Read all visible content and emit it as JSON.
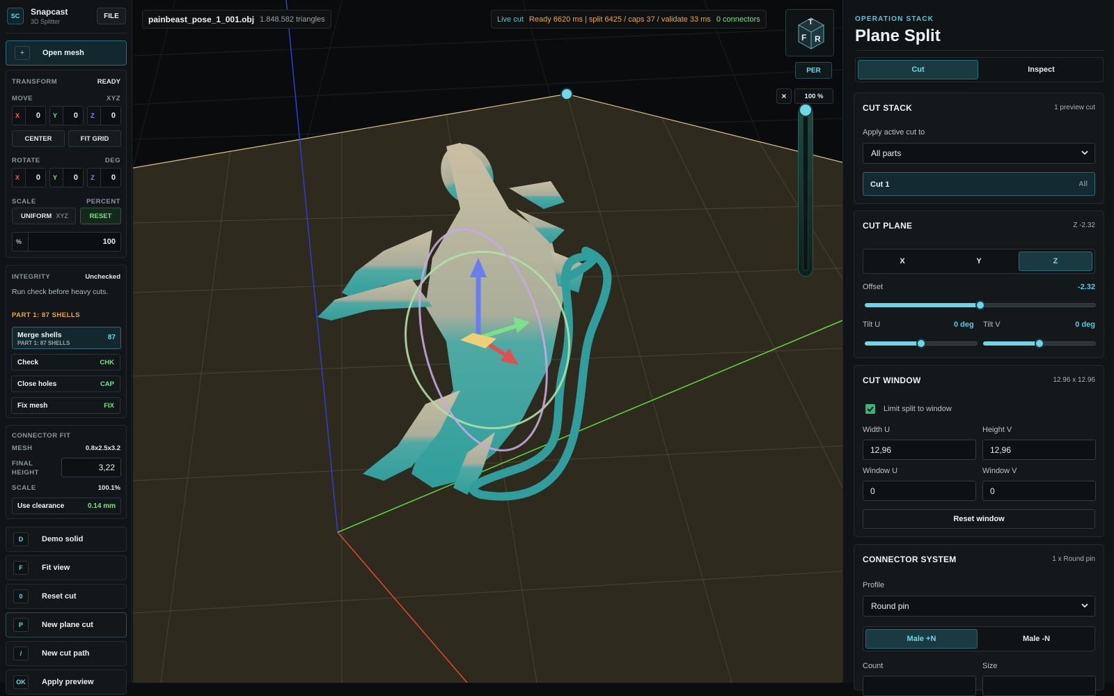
{
  "app": {
    "logo": "SC",
    "name": "Snapcast",
    "subtitle": "3D Splitter",
    "file_label": "FILE"
  },
  "left": {
    "open_mesh": {
      "icon": "+",
      "label": "Open mesh"
    },
    "transform": {
      "title": "TRANSFORM",
      "status": "READY",
      "move_label": "MOVE",
      "move_unit": "XYZ",
      "move": [
        {
          "axis": "X",
          "value": "0"
        },
        {
          "axis": "Y",
          "value": "0"
        },
        {
          "axis": "Z",
          "value": "0"
        }
      ],
      "center": "CENTER",
      "fit_grid": "FIT GRID",
      "rotate_label": "ROTATE",
      "rotate_unit": "DEG",
      "rotate": [
        {
          "axis": "X",
          "value": "0"
        },
        {
          "axis": "Y",
          "value": "0"
        },
        {
          "axis": "Z",
          "value": "0"
        }
      ],
      "scale_label": "SCALE",
      "scale_unit": "PERCENT",
      "uniform": "UNIFORM",
      "uniform_axes": "XYZ",
      "reset": "RESET",
      "percent_symbol": "%",
      "percent_value": "100"
    },
    "integrity": {
      "title": "INTEGRITY",
      "status": "Unchecked",
      "hint": "Run check before heavy cuts.",
      "part_title": "PART 1: 87 SHELLS",
      "merge": {
        "label": "Merge shells",
        "sub": "PART 1: 87 SHELLS",
        "count": "87"
      },
      "actions": [
        {
          "label": "Check",
          "key": "CHK"
        },
        {
          "label": "Close holes",
          "key": "CAP"
        },
        {
          "label": "Fix mesh",
          "key": "FIX"
        }
      ]
    },
    "connector_fit": {
      "title": "CONNECTOR FIT",
      "mesh_label": "MESH",
      "mesh_value": "0.8x2.5x3.2",
      "final_height_label": "FINAL HEIGHT",
      "final_height_value": "3,22",
      "scale_label": "SCALE",
      "scale_value": "100.1%",
      "clearance_label": "Use clearance",
      "clearance_value": "0.14 mm"
    },
    "nav": [
      {
        "key": "D",
        "label": "Demo solid"
      },
      {
        "key": "F",
        "label": "Fit view"
      },
      {
        "key": "0",
        "label": "Reset cut"
      },
      {
        "key": "P",
        "label": "New plane cut"
      },
      {
        "key": "/",
        "label": "New cut path"
      },
      {
        "key": "OK",
        "label": "Apply preview"
      }
    ]
  },
  "viewport": {
    "file_name": "painbeast_pose_1_001.obj",
    "triangles": "1.848.582 triangles",
    "live_label": "Live cut",
    "live_status": "Ready 6620 ms | split 6425 / caps 37 / validate 33 ms",
    "connectors": "0 connectors",
    "cube_faces": {
      "top": "T",
      "front": "F",
      "right": "R"
    },
    "projection": "PER",
    "zoom_close": "×",
    "zoom_value": "100 %",
    "colors": {
      "floor": "#2e2a1e",
      "grid": "#4a4432",
      "x_axis": "#e2492c",
      "y_axis": "#5fd93a",
      "z_axis": "#2a3fd8",
      "model_top": "#cabfa3",
      "model_bottom": "#2f9e9c"
    }
  },
  "right": {
    "section": "OPERATION STACK",
    "title": "Plane Split",
    "tabs": [
      {
        "label": "Cut",
        "active": true
      },
      {
        "label": "Inspect",
        "active": false
      }
    ],
    "cut_stack": {
      "title": "CUT STACK",
      "meta": "1 preview cut",
      "apply_label": "Apply active cut to",
      "apply_value": "All parts",
      "cut_name": "Cut 1",
      "cut_scope": "All"
    },
    "cut_plane": {
      "title": "CUT PLANE",
      "meta": "Z -2.32",
      "axes": [
        {
          "label": "X",
          "active": false
        },
        {
          "label": "Y",
          "active": false
        },
        {
          "label": "Z",
          "active": true
        }
      ],
      "offset_label": "Offset",
      "offset_value": "-2.32",
      "offset_fraction": 0.5,
      "tilt_u_label": "Tilt U",
      "tilt_u_value": "0 deg",
      "tilt_u_fraction": 0.5,
      "tilt_v_label": "Tilt V",
      "tilt_v_value": "0 deg",
      "tilt_v_fraction": 0.5
    },
    "cut_window": {
      "title": "CUT WINDOW",
      "meta": "12.96 x 12.96",
      "limit_label": "Limit split to window",
      "limit_checked": true,
      "width_label": "Width U",
      "width_value": "12,96",
      "height_label": "Height V",
      "height_value": "12,96",
      "win_u_label": "Window U",
      "win_u_value": "0",
      "win_v_label": "Window V",
      "win_v_value": "0",
      "reset_label": "Reset window"
    },
    "connector_system": {
      "title": "CONNECTOR SYSTEM",
      "meta": "1 x Round pin",
      "profile_label": "Profile",
      "profile_value": "Round pin",
      "genders": [
        {
          "label": "Male +N",
          "active": true
        },
        {
          "label": "Male -N",
          "active": false
        }
      ],
      "count_label": "Count",
      "size_label": "Size"
    }
  }
}
